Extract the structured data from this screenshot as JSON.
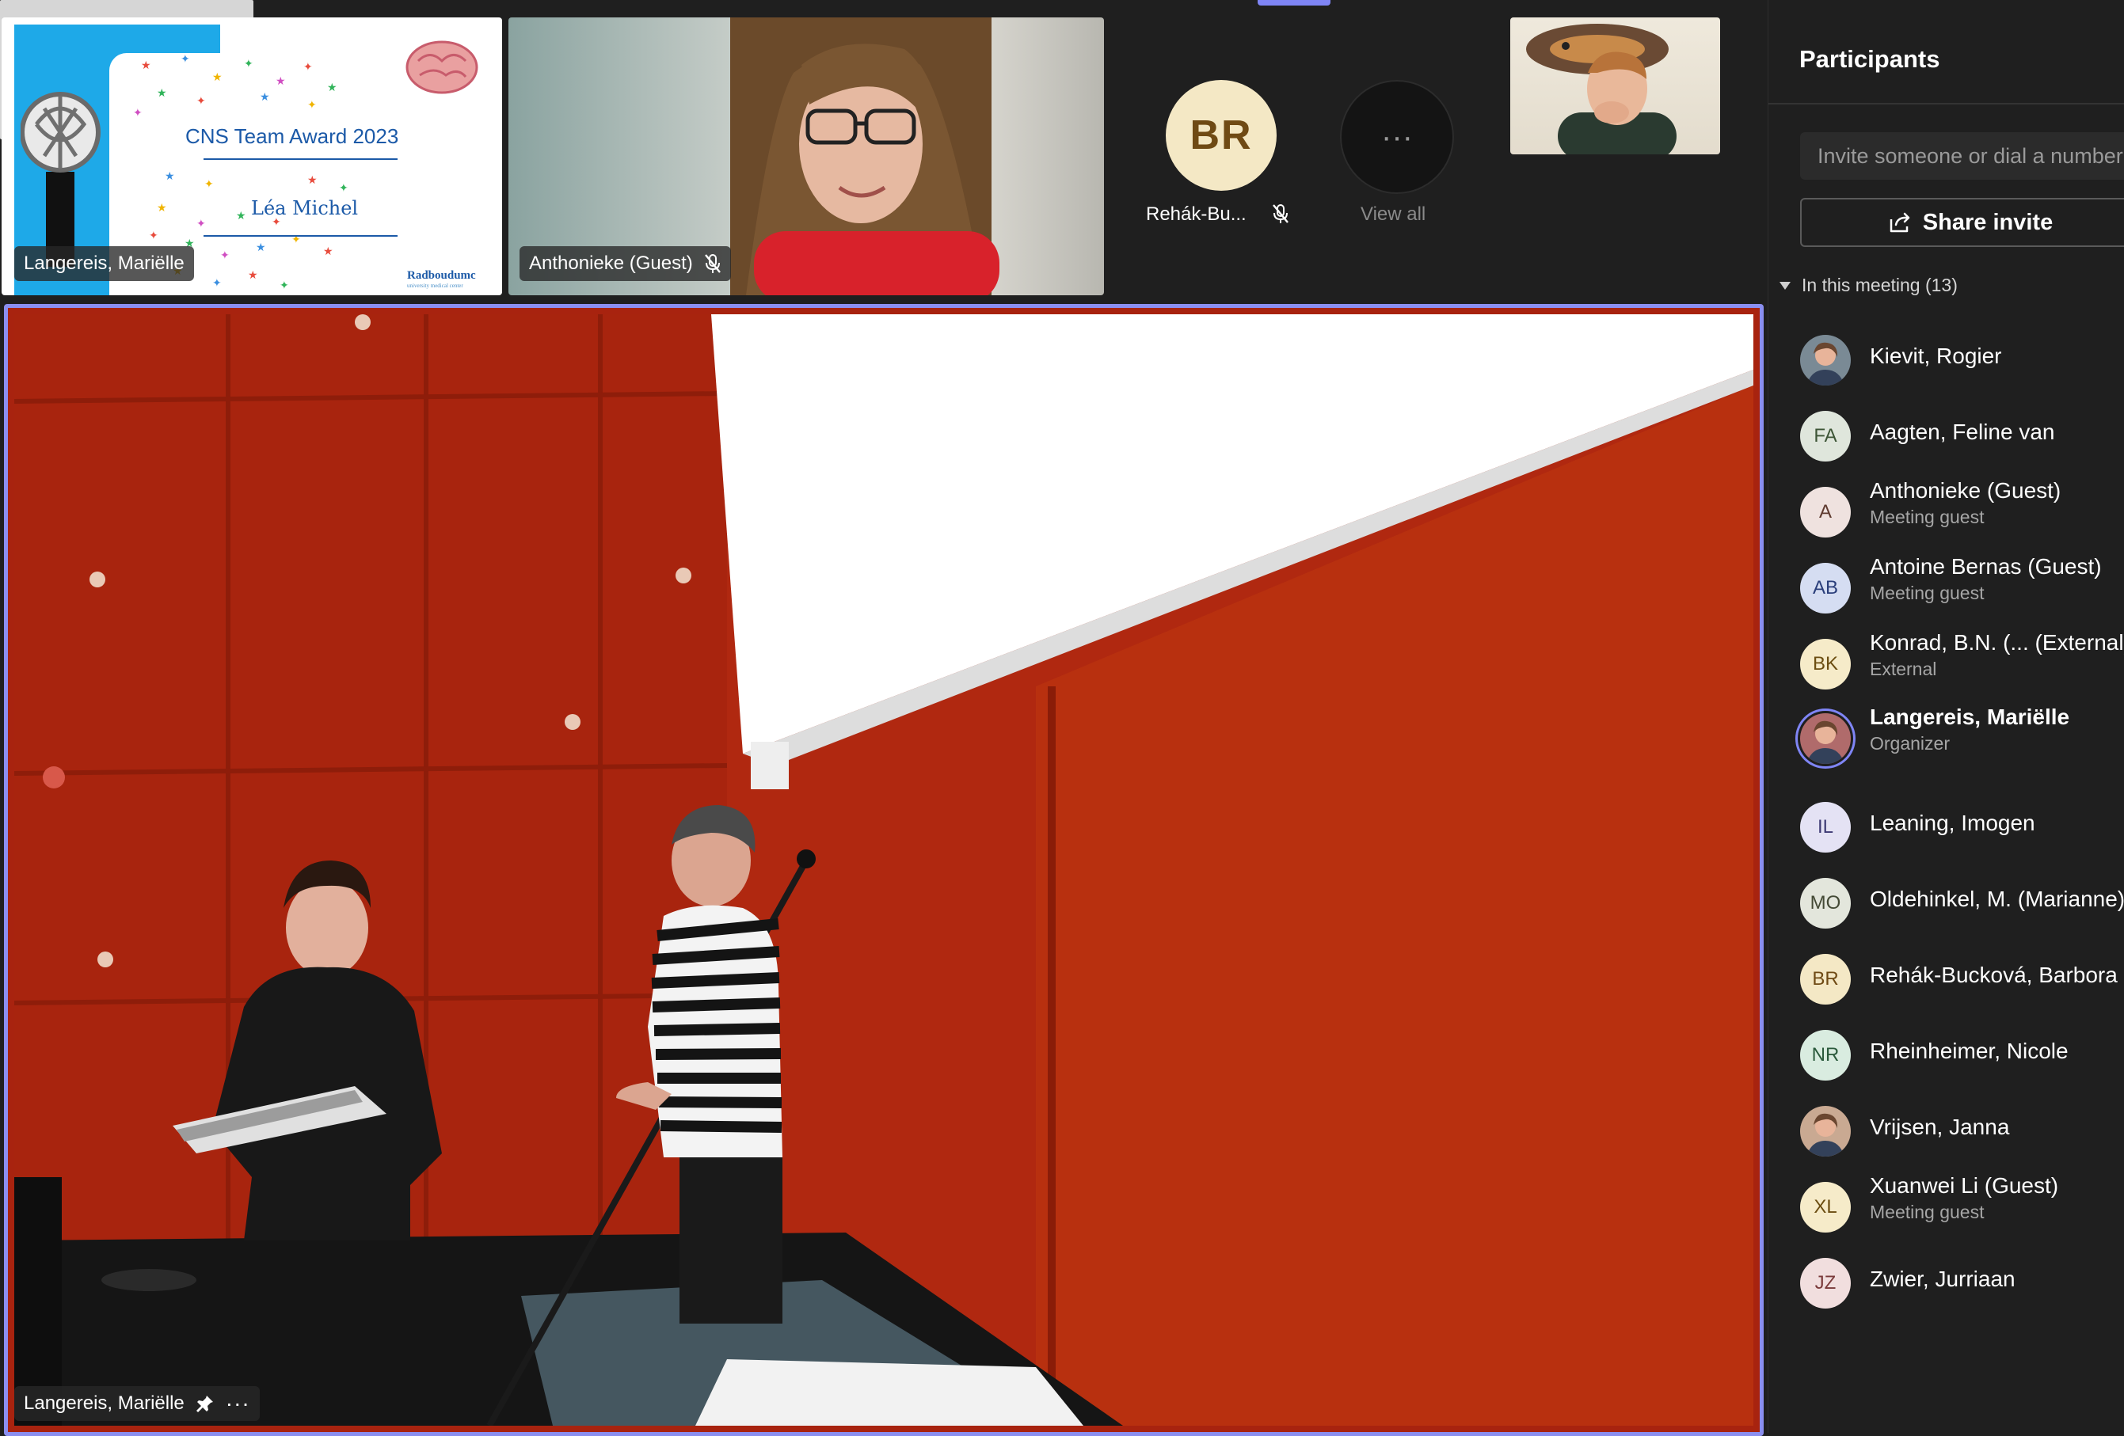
{
  "tiles": {
    "slide": {
      "title": "CNS Team Award 2023",
      "name": "Léa Michel",
      "brand": "Radboudumc",
      "brand_sub": "university medical center",
      "speaker": "Langereis, Mariëlle"
    },
    "anthonieke": {
      "speaker": "Anthonieke (Guest)"
    },
    "br_tile": {
      "initials": "BR",
      "name": "Rehák-Bu..."
    },
    "view_all": {
      "label": "View all"
    }
  },
  "main_stage": {
    "speaker": "Langereis, Mariëlle"
  },
  "panel": {
    "title": "Participants",
    "invite_placeholder": "Invite someone or dial a number",
    "share_label": "Share invite",
    "section_label": "In this meeting (13)",
    "participants": [
      {
        "initials": "",
        "name": "Kievit, Rogier",
        "sub": "",
        "photo": true,
        "bg": "#7a8a95"
      },
      {
        "initials": "FA",
        "name": "Aagten, Feline van",
        "sub": "",
        "bg": "#dfe6dc",
        "fg": "#3d5536"
      },
      {
        "initials": "A",
        "name": "Anthonieke (Guest)",
        "sub": "Meeting guest",
        "bg": "#efe2df",
        "fg": "#5e3a2f"
      },
      {
        "initials": "AB",
        "name": "Antoine Bernas (Guest)",
        "sub": "Meeting guest",
        "bg": "#d5ddf2",
        "fg": "#2a3e7a"
      },
      {
        "initials": "BK",
        "name": "Konrad, B.N. (... (External)",
        "sub": "External",
        "bg": "#f6ebc9",
        "fg": "#6c4e12"
      },
      {
        "initials": "",
        "name": "Langereis, Mariëlle",
        "sub": "Organizer",
        "photo": true,
        "bg": "#b06b6b",
        "bold": true
      },
      {
        "initials": "IL",
        "name": "Leaning, Imogen",
        "sub": "",
        "bg": "#e4e2f4",
        "fg": "#3d3a74"
      },
      {
        "initials": "MO",
        "name": "Oldehinkel, M. (Marianne)",
        "sub": "",
        "bg": "#e3e6dc",
        "fg": "#444a36"
      },
      {
        "initials": "BR",
        "name": "Rehák-Bucková, Barbora",
        "sub": "",
        "bg": "#f4e8c5",
        "fg": "#6f4a14"
      },
      {
        "initials": "NR",
        "name": "Rheinheimer, Nicole",
        "sub": "",
        "bg": "#d9ece0",
        "fg": "#2b5a3c"
      },
      {
        "initials": "",
        "name": "Vrijsen, Janna",
        "sub": "",
        "photo": true,
        "bg": "#c9a992"
      },
      {
        "initials": "XL",
        "name": "Xuanwei Li (Guest)",
        "sub": "Meeting guest",
        "bg": "#f6ebc9",
        "fg": "#6c4e12"
      },
      {
        "initials": "JZ",
        "name": "Zwier, Jurriaan",
        "sub": "",
        "bg": "#f1dede",
        "fg": "#7a3a3a"
      }
    ]
  }
}
